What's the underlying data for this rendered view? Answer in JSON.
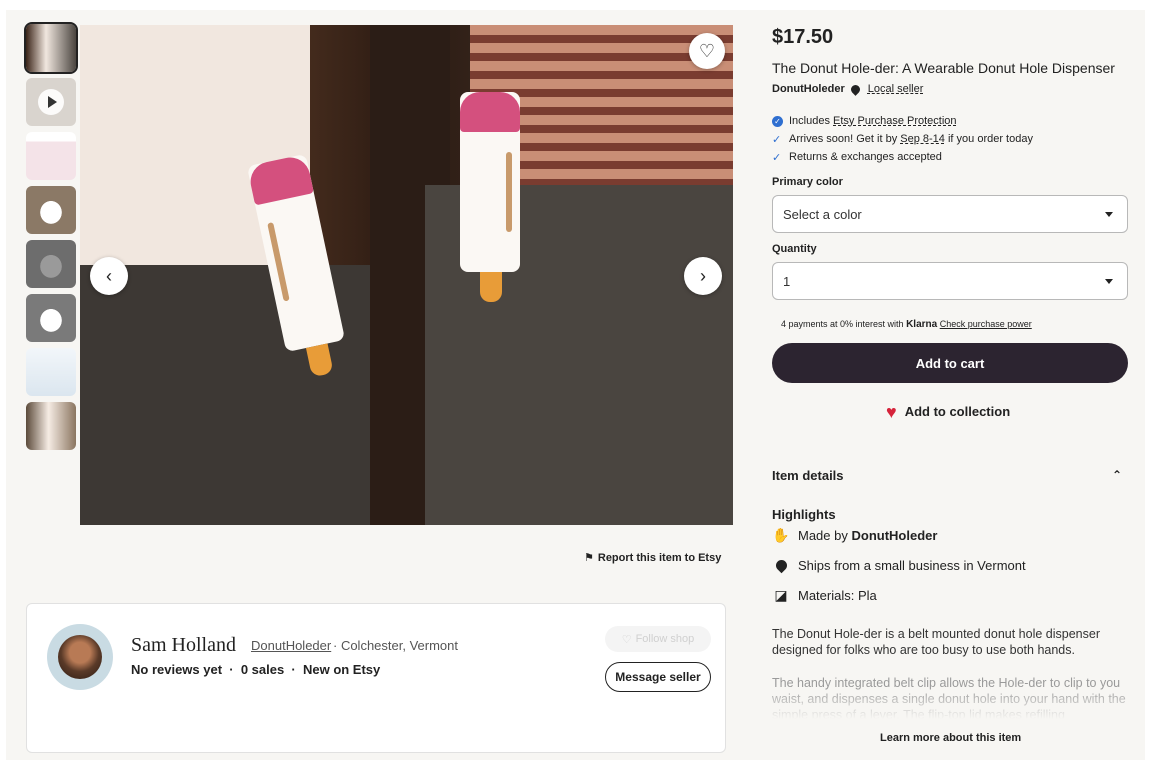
{
  "listing": {
    "price": "$17.50",
    "title": "The Donut Hole-der: A Wearable Donut Hole Dispenser",
    "shop_name": "DonutHoleder",
    "local_seller": "Local seller",
    "perks": [
      {
        "icon": "verified-badge-icon",
        "text_pre": "Includes ",
        "text_link": "Etsy Purchase Protection",
        "text_post": ""
      },
      {
        "icon": "check-icon",
        "text_pre": "Arrives soon! Get it by ",
        "text_link": "Sep 8-14",
        "text_post": " if you order today"
      },
      {
        "icon": "check-icon",
        "text_pre": "Returns & exchanges accepted",
        "text_link": "",
        "text_post": ""
      }
    ],
    "primary_color_label": "Primary color",
    "primary_color_value": "Select a color",
    "quantity_label": "Quantity",
    "quantity_value": "1",
    "klarna_pre": "4 payments at 0% interest with ",
    "klarna_brand": "Klarna",
    "klarna_link": "Check purchase power",
    "add_to_cart": "Add to cart",
    "add_to_collection": "Add to collection",
    "item_details": "Item details",
    "highlights_title": "Highlights",
    "highlights": {
      "made_by_pre": "Made by ",
      "made_by_shop": "DonutHoleder",
      "ships_from": "Ships from a small business in Vermont",
      "materials": "Materials: Pla"
    },
    "description_1": "The Donut Hole-der is a belt mounted donut hole dispenser designed for folks who are too busy to use both hands.",
    "description_2": "The handy integrated belt clip allows the Hole-der to clip to you waist, and dispenses a single donut hole into your hand with the simple press of a lever. The flip-top lid makes refilling",
    "learn_more": "Learn more about this item"
  },
  "gallery": {
    "report": "Report this item to Etsy",
    "thumbnail_count": 8
  },
  "seller": {
    "name": "Sam Holland",
    "shop": "DonutHoleder",
    "location": "· Colchester, Vermont",
    "meta": "No reviews yet  ·  0 sales  ·  New on Etsy",
    "follow": "Follow shop",
    "message": "Message seller"
  },
  "colors": {
    "primary_button": "#2c2430",
    "heart": "#d6233a",
    "check": "#2f6fd0"
  }
}
